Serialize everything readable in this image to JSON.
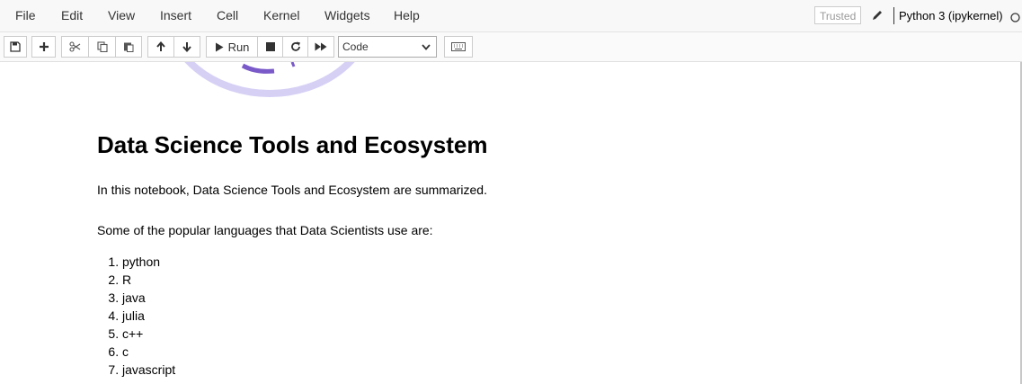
{
  "menubar": {
    "items": [
      "File",
      "Edit",
      "View",
      "Insert",
      "Cell",
      "Kernel",
      "Widgets",
      "Help"
    ],
    "trusted_label": "Trusted",
    "kernel_name": "Python 3 (ipykernel)"
  },
  "toolbar": {
    "run_label": "Run",
    "cell_type_value": "Code"
  },
  "notebook": {
    "title": "Data Science Tools and Ecosystem",
    "intro": "In this notebook, Data Science Tools and Ecosystem are summarized.",
    "languages_intro": "Some of the popular languages that Data Scientists use are:",
    "languages": [
      "python",
      "R",
      "java",
      "julia",
      "c++",
      "c",
      "javascript"
    ]
  },
  "colors": {
    "logo_arc": "#d6d0f5",
    "logo_accent": "#7a5ac8"
  }
}
